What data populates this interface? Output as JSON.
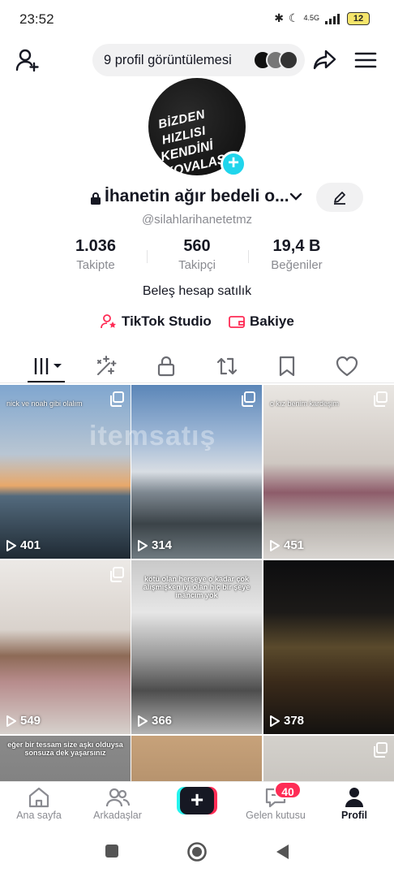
{
  "status_bar": {
    "time": "23:52",
    "network": "4.5G",
    "battery": "12"
  },
  "top_bar": {
    "views_label": "9 profil görüntülemesi"
  },
  "profile": {
    "name": "İhanetin ağır bedeli o...",
    "username": "@silahlarihanetetmz",
    "avatar_text_line1": "BİZDEN HIZLISI",
    "avatar_text_line2": "KENDİNİ KOVALASIN",
    "bio": "Beleş hesap satılık"
  },
  "stats": [
    {
      "value": "1.036",
      "label": "Takipte"
    },
    {
      "value": "560",
      "label": "Takipçi"
    },
    {
      "value": "19,4 B",
      "label": "Beğeniler"
    }
  ],
  "links": {
    "studio": "TikTok Studio",
    "balance": "Bakiye"
  },
  "grid": {
    "watermark": "itemsatış",
    "tiles": [
      {
        "caption": "nick ve noah gibi olalım",
        "count": "401"
      },
      {
        "caption": "",
        "count": "314"
      },
      {
        "caption": "o kız benim kardeşim",
        "count": "451"
      },
      {
        "caption": "",
        "count": "549"
      },
      {
        "caption": "kötü olan herşeye o kadar çok alışmışken iyi olan hiç bir şeye inancım yok",
        "count": "366"
      },
      {
        "caption": "",
        "count": "378"
      },
      {
        "caption": "eğer bir tessam size aşkı olduysa sonsuza dek yaşarsınız",
        "count": ""
      },
      {
        "caption": "",
        "count": ""
      },
      {
        "caption": "",
        "count": ""
      }
    ]
  },
  "bottom_nav": {
    "home": "Ana sayfa",
    "friends": "Arkadaşlar",
    "inbox": "Gelen kutusu",
    "inbox_badge": "40",
    "profile": "Profil"
  },
  "colors": {
    "accent_pink": "#fe2c55",
    "accent_cyan": "#25f4ee",
    "plus_blue": "#20d5ec"
  }
}
